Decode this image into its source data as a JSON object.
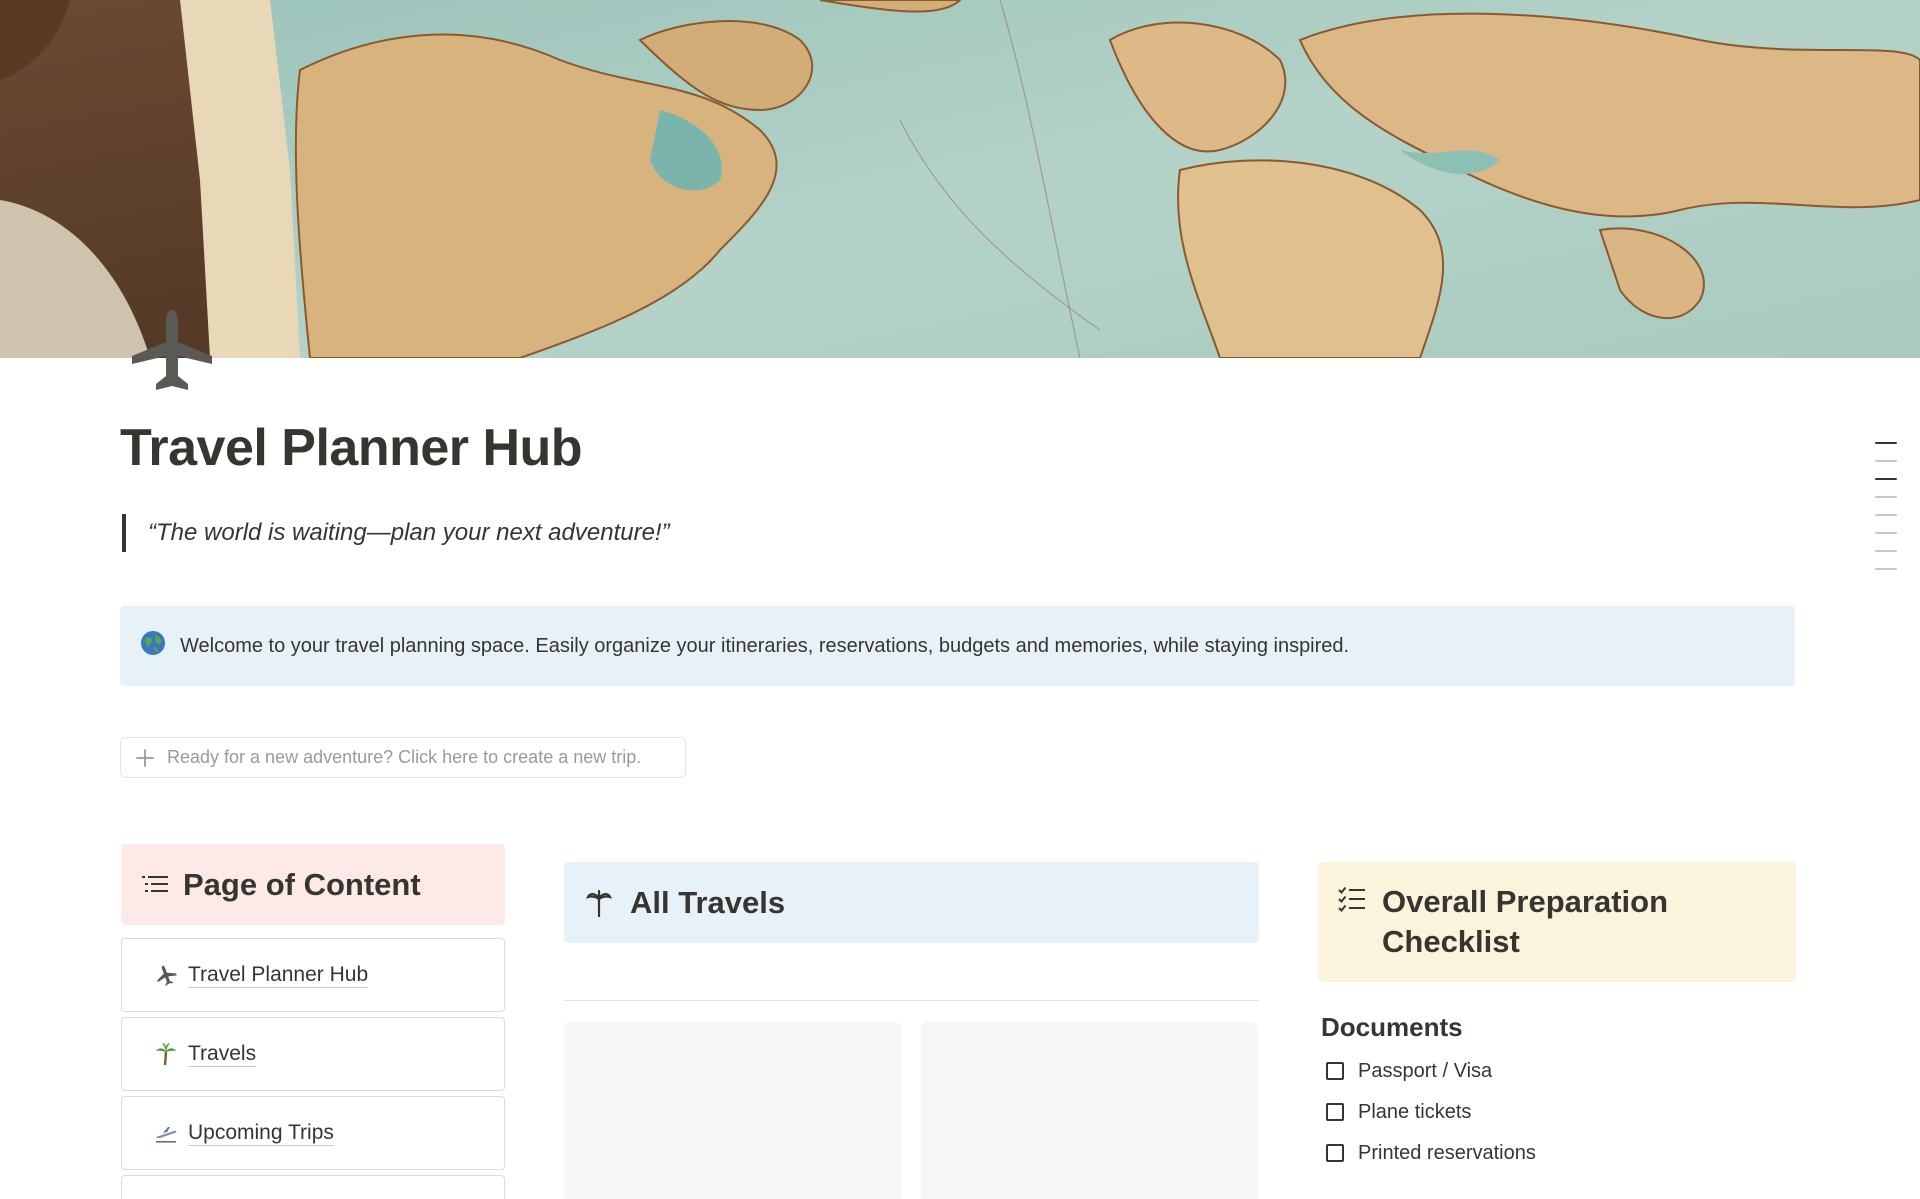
{
  "page": {
    "title": "Travel Planner Hub",
    "quote": "“The world is waiting—plan your next adventure!”",
    "callout": {
      "icon": "globe-icon",
      "text": "Welcome to your travel planning space. Easily organize your itineraries, reservations, budgets and memories, while staying inspired."
    },
    "new_trip_button": "Ready for a new adventure? Click here to create a new trip."
  },
  "toc": {
    "title": "Page of Content",
    "items": [
      {
        "label": "Travel Planner Hub",
        "icon": "airplane-icon"
      },
      {
        "label": "Travels",
        "icon": "palm-tree-icon"
      },
      {
        "label": "Upcoming Trips",
        "icon": "plane-departure-icon"
      }
    ]
  },
  "travels": {
    "title": "All Travels",
    "icon": "palm-tree-icon"
  },
  "checklist": {
    "title": "Overall Preparation Checklist",
    "icon": "checklist-icon",
    "section": "Documents",
    "items": [
      "Passport / Visa",
      "Plane tickets",
      "Printed reservations"
    ]
  },
  "colors": {
    "text": "#37352f",
    "callout_bg": "#e7f1f8",
    "toc_header_bg": "#fde9e8",
    "checklist_header_bg": "#fbf3db",
    "muted": "#9b9a97"
  }
}
